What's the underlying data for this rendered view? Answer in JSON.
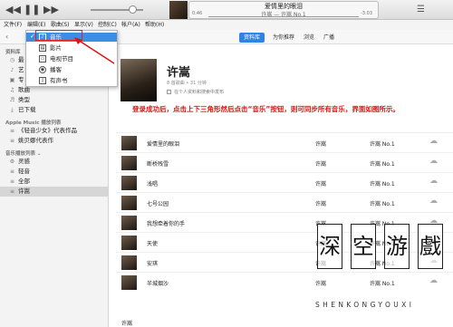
{
  "window": {
    "now_playing": {
      "title": "爱情里的眼泪",
      "subtitle": "许嵩 — 许嵩 No.1",
      "elapsed": "0:46",
      "remaining": "-3:03"
    }
  },
  "menubar": [
    "文件(F)",
    "编辑(E)",
    "歌曲(S)",
    "显示(V)",
    "控制(C)",
    "帐户(A)",
    "帮助(H)"
  ],
  "nav": {
    "tabs": [
      "资料库",
      "为你推荐",
      "浏览",
      "广播"
    ],
    "active_tab": "资料库"
  },
  "media_menu": {
    "items": [
      "音乐",
      "影片",
      "电视节目",
      "播客",
      "有声书"
    ],
    "selected": "音乐"
  },
  "sidebar": {
    "library_header": "资料库",
    "library_items": [
      "最",
      "艺",
      "专",
      "歌曲",
      "类型",
      "已下载"
    ],
    "apple_music_header": "Apple Music 播放列表",
    "apple_music_items": [
      "《轻音少女》代表作品",
      "姚贝娜代表作"
    ],
    "playlists_header": "音乐播放列表 ⌄",
    "playlists_items": [
      "灵感",
      "轻音",
      "全部",
      "许嵩"
    ]
  },
  "artist": {
    "name": "许嵩",
    "meta": "8 首歌曲 • 31 分钟",
    "shuffle_option": "在个人资料和搜索中发布"
  },
  "annotation": "登录成功后，点击上下三角形然后点击“音乐”按钮，则可同步所有音乐，界面如图所示。",
  "album_header": "许嵩",
  "tracks": [
    {
      "title": "爱情里的眼泪",
      "artist": "许嵩",
      "album": "许嵩 No.1"
    },
    {
      "title": "断桥残雪",
      "artist": "许嵩",
      "album": "许嵩 No.1"
    },
    {
      "title": "浅唱",
      "artist": "许嵩",
      "album": "许嵩 No.1"
    },
    {
      "title": "七号公园",
      "artist": "许嵩",
      "album": "许嵩 No.1"
    },
    {
      "title": "我想牵着你的手",
      "artist": "许嵩",
      "album": "许嵩 No.1"
    },
    {
      "title": "天使",
      "artist": "许嵩",
      "album": "许嵩 No.1"
    },
    {
      "title": "安琪",
      "artist": "许嵩",
      "album": "许嵩 No.1"
    },
    {
      "title": "半城烟沙",
      "artist": "许嵩",
      "album": "许嵩 No.1"
    }
  ],
  "watermark": {
    "chars": [
      "深",
      "空",
      "游",
      "戲"
    ],
    "subtitle": "SHENKONGYOUXI"
  },
  "colors": {
    "accent": "#2d84e4",
    "annotation_red": "#e01414"
  }
}
